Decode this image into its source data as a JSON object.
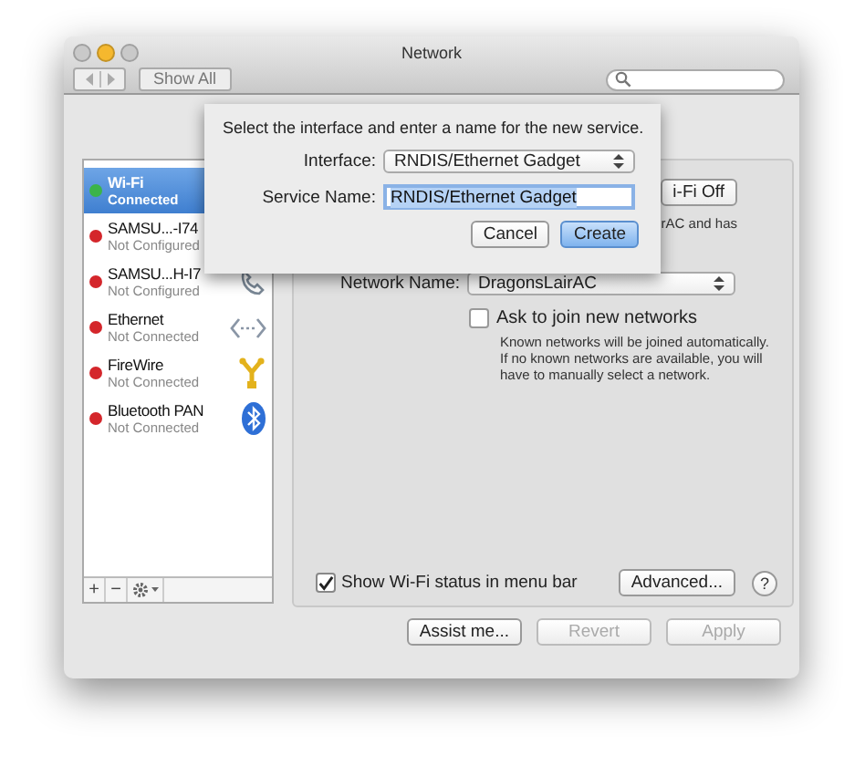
{
  "window": {
    "title": "Network",
    "traffic_lights": [
      {
        "kind": "close",
        "active": false
      },
      {
        "kind": "minimize",
        "active": true
      },
      {
        "kind": "zoom",
        "active": false
      }
    ]
  },
  "toolbar": {
    "show_all": "Show All"
  },
  "sheet": {
    "prompt": "Select the interface and enter a name for the new service.",
    "interface_label": "Interface:",
    "interface_value": "RNDIS/Ethernet Gadget",
    "service_label": "Service Name:",
    "service_value": "RNDIS/Ethernet Gadget",
    "service_value_selected": true,
    "buttons": [
      {
        "label": "Cancel",
        "kind": "normal"
      },
      {
        "label": "Create",
        "kind": "default"
      }
    ]
  },
  "sidebar": {
    "services": [
      {
        "name": "Wi-Fi",
        "status": "Connected",
        "color": "#3bb44a",
        "selected": true
      },
      {
        "name": "SAMSU...-I74",
        "status": "Not Configured",
        "color": "#d4262b",
        "selected": false
      },
      {
        "name": "SAMSU...H-I7",
        "status": "Not Configured",
        "color": "#d4262b",
        "selected": false,
        "kind": "phone"
      },
      {
        "name": "Ethernet",
        "status": "Not Connected",
        "color": "#d4262b",
        "selected": false,
        "kind": "ethernet"
      },
      {
        "name": "FireWire",
        "status": "Not Connected",
        "color": "#d4262b",
        "selected": false,
        "kind": "firewire"
      },
      {
        "name": "Bluetooth PAN",
        "status": "Not Connected",
        "color": "#d4262b",
        "selected": false,
        "kind": "bluetooth"
      }
    ],
    "add": "+",
    "remove": "−"
  },
  "panel": {
    "wifi_button": "i-Fi Off",
    "status_text": "rAC and has",
    "network_name_label": "Network Name:",
    "network_name_value": "DragonsLairAC",
    "ask_checkbox": {
      "label": "Ask to join new networks",
      "checked": false
    },
    "ask_note": "Known networks will be joined automatically. If no known networks are available, you will have to manually select a network.",
    "show_status_checkbox": {
      "label": "Show Wi-Fi status in menu bar",
      "checked": true
    },
    "advanced": "Advanced...",
    "help": "?"
  },
  "footer": {
    "buttons": [
      {
        "label": "Assist me...",
        "disabled": false
      },
      {
        "label": "Revert",
        "disabled": true
      },
      {
        "label": "Apply",
        "disabled": true
      }
    ]
  }
}
